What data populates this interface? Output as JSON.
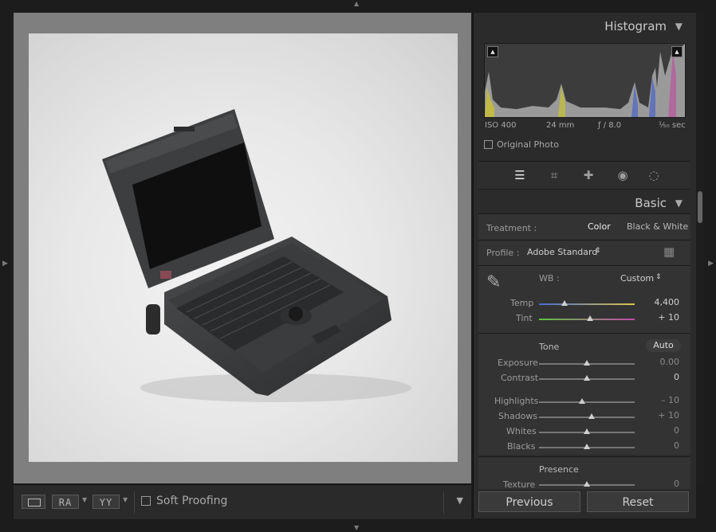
{
  "panels": {
    "histogram": {
      "title": "Histogram",
      "exif": {
        "iso": "ISO 400",
        "focal": "24 mm",
        "aperture": "ƒ / 8.0",
        "shutter": "¹⁄₅₀ sec"
      },
      "original_photo_label": "Original Photo"
    },
    "basic": {
      "title": "Basic",
      "treatment_label": "Treatment :",
      "treatment_color": "Color",
      "treatment_bw": "Black & White",
      "profile_label": "Profile :",
      "profile_value": "Adobe Standard",
      "wb_label": "WB :",
      "wb_value": "Custom",
      "temp": {
        "label": "Temp",
        "value": "4,400",
        "position": 0.27
      },
      "tint": {
        "label": "Tint",
        "value": "+ 10",
        "position": 0.53
      },
      "tone_label": "Tone",
      "auto_label": "Auto",
      "exposure": {
        "label": "Exposure",
        "value": "0.00",
        "position": 0.5
      },
      "contrast": {
        "label": "Contrast",
        "value": "0",
        "position": 0.5
      },
      "highlights": {
        "label": "Highlights",
        "value": "– 10",
        "position": 0.45
      },
      "shadows": {
        "label": "Shadows",
        "value": "+ 10",
        "position": 0.55
      },
      "whites": {
        "label": "Whites",
        "value": "0",
        "position": 0.5
      },
      "blacks": {
        "label": "Blacks",
        "value": "0",
        "position": 0.5
      },
      "presence_label": "Presence",
      "texture": {
        "label": "Texture",
        "value": "0",
        "position": 0.5
      }
    }
  },
  "toolbar": {
    "ra_label": "RA",
    "yy_label": "YY",
    "soft_proofing_label": "Soft Proofing"
  },
  "buttons": {
    "previous": "Previous",
    "reset": "Reset"
  },
  "colors": {
    "panel_bg": "#2b2b2b",
    "viewer_bg": "#7f7f7f"
  }
}
